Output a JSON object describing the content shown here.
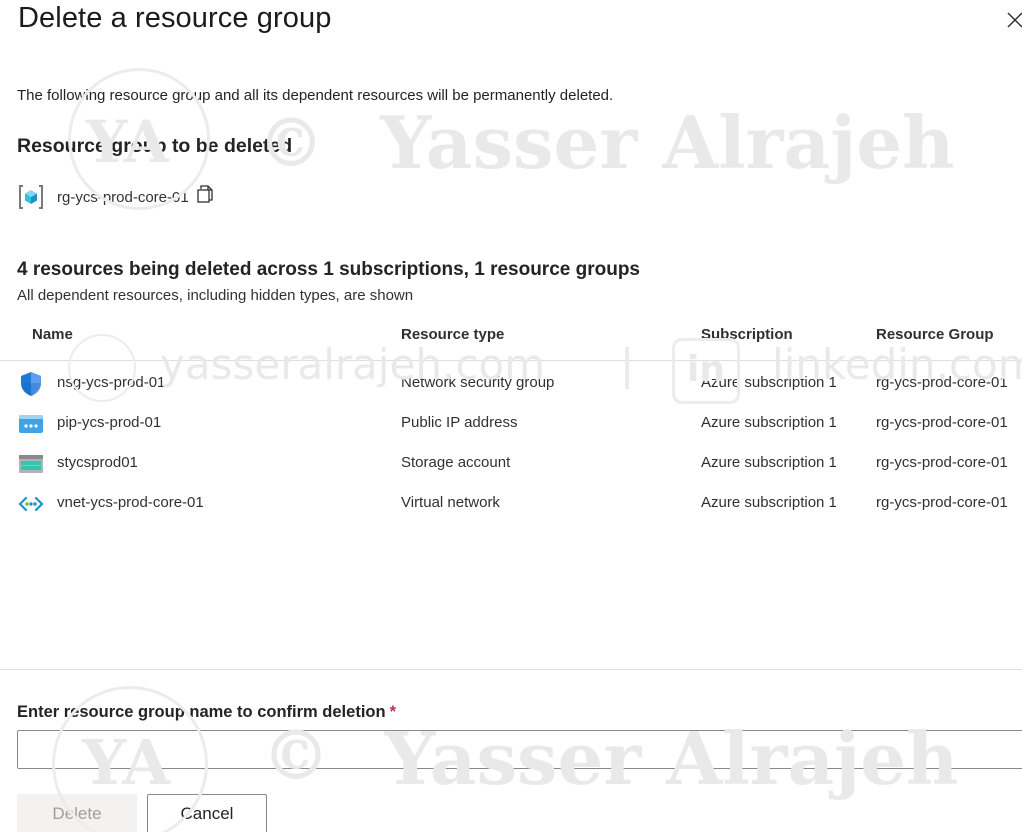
{
  "dialog": {
    "title": "Delete a resource group",
    "description": "The following resource group and all its dependent resources will be permanently deleted.",
    "section_title": "Resource group to be deleted",
    "resource_group_name": "rg-ycs-prod-core-01"
  },
  "resources": {
    "summary": "4 resources being deleted across 1 subscriptions, 1 resource groups",
    "note": "All dependent resources, including hidden types, are shown",
    "columns": {
      "name": "Name",
      "type": "Resource type",
      "subscription": "Subscription",
      "group": "Resource Group"
    },
    "rows": [
      {
        "icon": "network-security-group-icon",
        "name": "nsg-ycs-prod-01",
        "type": "Network security group",
        "subscription": "Azure subscription 1",
        "group": "rg-ycs-prod-core-01"
      },
      {
        "icon": "public-ip-icon",
        "name": "pip-ycs-prod-01",
        "type": "Public IP address",
        "subscription": "Azure subscription 1",
        "group": "rg-ycs-prod-core-01"
      },
      {
        "icon": "storage-account-icon",
        "name": "stycsprod01",
        "type": "Storage account",
        "subscription": "Azure subscription 1",
        "group": "rg-ycs-prod-core-01"
      },
      {
        "icon": "virtual-network-icon",
        "name": "vnet-ycs-prod-core-01",
        "type": "Virtual network",
        "subscription": "Azure subscription 1",
        "group": "rg-ycs-prod-core-01"
      }
    ]
  },
  "confirm": {
    "label": "Enter resource group name to confirm deletion",
    "required_mark": "*",
    "value": "",
    "placeholder": ""
  },
  "buttons": {
    "delete": "Delete",
    "cancel": "Cancel"
  },
  "watermark": {
    "logo": "YA",
    "symbol": "©",
    "name": "Yasser Alrajeh",
    "site": "yasseralrajeh.com",
    "separator": "|",
    "social_icon": "in",
    "social": "linkedin.com"
  },
  "colors": {
    "accent": "#0078d4",
    "required": "#c4314b",
    "disabled_bg": "#f3f2f1",
    "disabled_text": "#a19f9d",
    "divider": "#e1dfdd"
  }
}
